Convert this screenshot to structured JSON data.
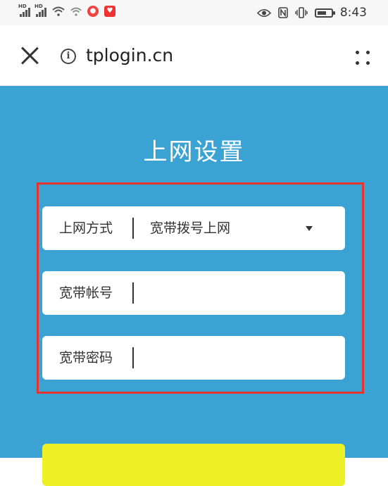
{
  "status_bar": {
    "time": "8:43",
    "left_icons": [
      "signal-icon",
      "signal-icon",
      "wifi-icon",
      "wifi-icon",
      "app-icon",
      "app-icon"
    ],
    "right_icons": [
      "eye-icon",
      "nfc-icon",
      "vibrate-icon",
      "battery-icon"
    ]
  },
  "browser": {
    "url": "tplogin.cn",
    "close_icon": "close-icon",
    "info_icon": "info-icon",
    "more_icon": "more-icon"
  },
  "page": {
    "title": "上网设置",
    "fields": {
      "connection_type": {
        "label": "上网方式",
        "value": "宽带拨号上网"
      },
      "account": {
        "label": "宽带帐号",
        "value": ""
      },
      "password": {
        "label": "宽带密码",
        "value": ""
      }
    }
  },
  "colors": {
    "background": "#3aa3d4",
    "highlight_border": "#e8342f",
    "button": "#eef026"
  }
}
